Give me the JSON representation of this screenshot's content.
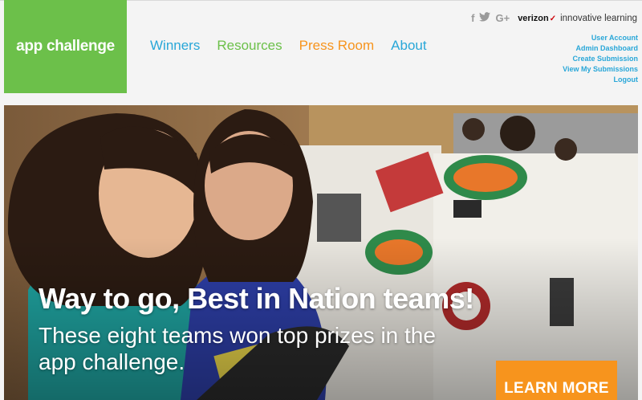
{
  "logo": {
    "text": "app challenge",
    "bg": "#6cc04a"
  },
  "nav": [
    {
      "label": "Winners",
      "color": "#29a7d8"
    },
    {
      "label": "Resources",
      "color": "#6cc04a"
    },
    {
      "label": "Press Room",
      "color": "#f7941d"
    },
    {
      "label": "About",
      "color": "#29a7d8"
    }
  ],
  "social": {
    "facebook": "f",
    "google": "G+",
    "icons": [
      "facebook-icon",
      "twitter-icon",
      "google-plus-icon"
    ]
  },
  "brand": {
    "name": "verizon",
    "tagline": "innovative learning",
    "check_color": "#cd040b"
  },
  "user_links": [
    "User Account",
    "Admin Dashboard",
    "Create Submission",
    "View My Submissions",
    "Logout"
  ],
  "hero": {
    "title": "Way to go, Best in Nation teams!",
    "subtitle": "These eight teams won top prizes in the app challenge.",
    "cta": "LEARN MORE",
    "cta_color": "#f7941d"
  }
}
